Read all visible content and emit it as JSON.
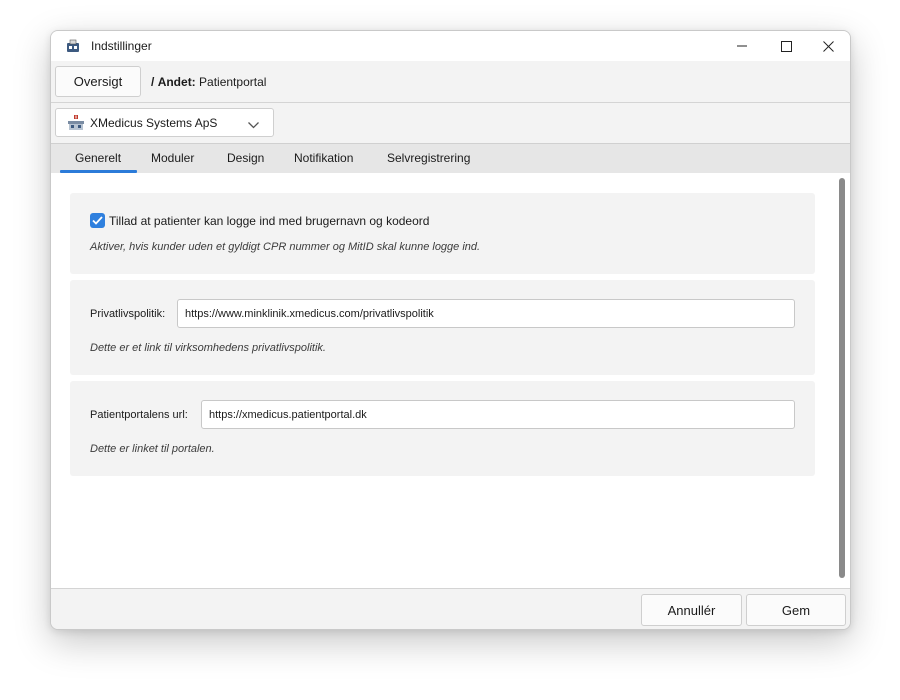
{
  "window": {
    "title": "Indstillinger"
  },
  "breadcrumb": {
    "overview_button": "Oversigt",
    "separator": "/",
    "section": "Andet:",
    "page": "Patientportal"
  },
  "organization": {
    "selected": "XMedicus Systems ApS"
  },
  "tabs": [
    {
      "label": "Generelt",
      "active": true
    },
    {
      "label": "Moduler",
      "active": false
    },
    {
      "label": "Design",
      "active": false
    },
    {
      "label": "Notifikation",
      "active": false
    },
    {
      "label": "Selvregistrering",
      "active": false
    }
  ],
  "settings": {
    "login": {
      "checkbox_label": "Tillad at patienter kan logge ind med brugernavn og kodeord",
      "checked": true,
      "hint": "Aktiver, hvis kunder uden et gyldigt CPR nummer og MitID skal kunne logge ind."
    },
    "privacy": {
      "label": "Privatlivspolitik:",
      "value": "https://www.minklinik.xmedicus.com/privatlivspolitik",
      "hint": "Dette er et link til virksomhedens privatlivspolitik."
    },
    "portal": {
      "label": "Patientportalens url:",
      "value": "https://xmedicus.patientportal.dk",
      "hint": "Dette er linket til portalen."
    }
  },
  "footer": {
    "cancel_label": "Annullér",
    "save_label": "Gem"
  },
  "colors": {
    "accent": "#2f80de",
    "tab_underline": "#2b7bd9"
  }
}
